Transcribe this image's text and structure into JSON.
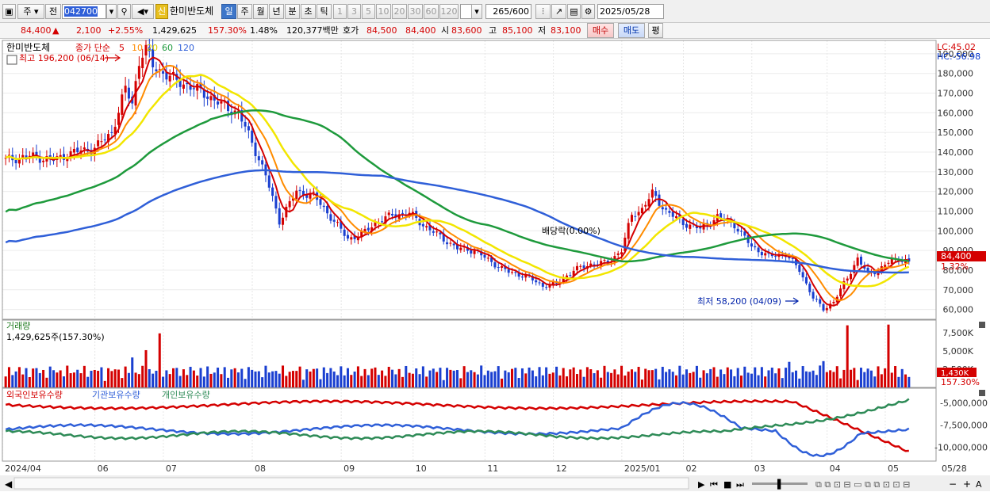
{
  "toolbar": {
    "market": "주",
    "prev": "전",
    "code": "042700",
    "new_badge": "신",
    "stock_name": "한미반도체",
    "periods": [
      "일",
      "주",
      "월",
      "년",
      "분",
      "초",
      "틱"
    ],
    "counts": [
      "1",
      "3",
      "5",
      "10",
      "20",
      "30",
      "60",
      "120"
    ],
    "count_value": "265",
    "count_max": "/600",
    "date": "2025/05/28"
  },
  "quote": {
    "price": "84,400",
    "arrow": "▲",
    "change": "2,100",
    "pct": "+2.55%",
    "volume": "1,429,625",
    "vol_ratio": "157.30%",
    "turnover": "1.48%",
    "amount": "120,377백만",
    "bid_label": "호가",
    "ask": "84,500",
    "bid": "84,400",
    "open_label": "시",
    "open": "83,600",
    "high_label": "고",
    "high": "85,100",
    "low_label": "저",
    "low": "83,100",
    "buy": "매수",
    "sell": "매도",
    "avg": "평"
  },
  "price_panel": {
    "title": "한미반도체",
    "legend_prefix": "종가 단순",
    "ma_periods": [
      "5",
      "10",
      "20",
      "60",
      "120"
    ],
    "ma_colors": [
      "#d40000",
      "#ff8c00",
      "#f2e600",
      "#1e9a3c",
      "#2f5fd8"
    ],
    "lc": "LC:45.02",
    "hc": "HC:-56.98",
    "high_note": "최고 196,200 (06/14)",
    "low_note": "최저 58,200 (04/09)",
    "dividend_note": "배당락(0.00%)",
    "current_tag": "84,400",
    "current_pct": "1.32%",
    "y_ticks": [
      "190,000",
      "180,000",
      "170,000",
      "160,000",
      "150,000",
      "140,000",
      "130,000",
      "120,000",
      "110,000",
      "100,000",
      "90,000",
      "80,000",
      "70,000",
      "60,000"
    ]
  },
  "volume_panel": {
    "title": "거래량",
    "info": "1,429,625주(157.30%)",
    "y_ticks": [
      "7,500K",
      "5,000K",
      "2,500K"
    ],
    "current_tag": "1,430K",
    "current_pct": "157.30%"
  },
  "holdings_panel": {
    "labels": [
      "외국인보유수량",
      "기관보유수량",
      "개인보유수량"
    ],
    "colors": [
      "#d40000",
      "#2f5fd8",
      "#2e8b57"
    ],
    "y_ticks": [
      "-5,000,000",
      "-7,500,000",
      "-10,000,000"
    ]
  },
  "x_axis": {
    "labels": [
      "2024/04",
      "06",
      "07",
      "08",
      "09",
      "10",
      "11",
      "12",
      "2025/01",
      "02",
      "03",
      "04",
      "05"
    ],
    "end_label": "05/28"
  },
  "chart_data": {
    "type": "candlestick",
    "title": "한미반도체",
    "y_range": [
      55000,
      196200
    ],
    "highest": {
      "value": 196200,
      "date": "06/14"
    },
    "lowest": {
      "value": 58200,
      "date": "04/09"
    },
    "last_close": 84400,
    "monthly_closes": [
      {
        "month": "2024/04",
        "close": 136000
      },
      {
        "month": "2024/05",
        "close": 140000
      },
      {
        "month": "2024/06",
        "close": 176000
      },
      {
        "month": "2024/07",
        "close": 160000
      },
      {
        "month": "2024/08",
        "close": 105000
      },
      {
        "month": "2024/09",
        "close": 97000
      },
      {
        "month": "2024/10",
        "close": 108000
      },
      {
        "month": "2024/11",
        "close": 87000
      },
      {
        "month": "2024/12",
        "close": 75000
      },
      {
        "month": "2025/01",
        "close": 113000
      },
      {
        "month": "2025/02",
        "close": 104000
      },
      {
        "month": "2025/03",
        "close": 87000
      },
      {
        "month": "2025/04",
        "close": 65000
      },
      {
        "month": "2025/05",
        "close": 84400
      }
    ]
  }
}
